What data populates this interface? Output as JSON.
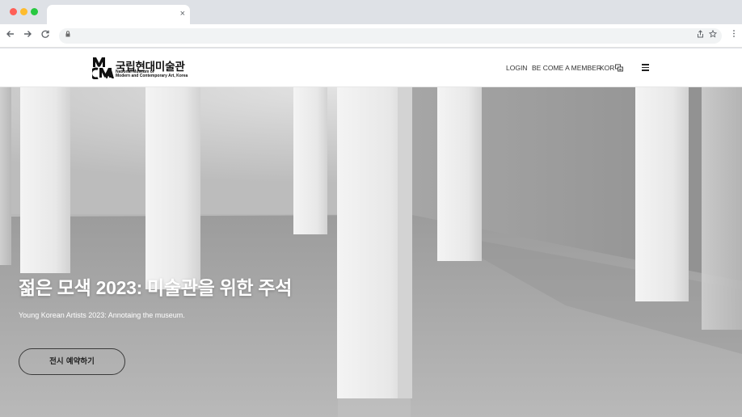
{
  "browser": {
    "tab_close": "×",
    "url": ""
  },
  "header": {
    "logo": {
      "mark": "MMCA",
      "korean_name": "국립현대미술관",
      "english_line1": "National Museum of",
      "english_line2": "Modern and Contemporary Art, Korea"
    },
    "login": "LOGIN",
    "become_member": "BE COME A MEMBER",
    "language": "KOR",
    "icons": {
      "language": "language-icon",
      "menu": "hamburger-menu-icon"
    }
  },
  "hero": {
    "title": "젊은 모색 2023: 미술관을 위한 주석",
    "subtitle": "Young Korean Artists 2023: Annotaing the museum.",
    "button": "전시 예약하기"
  },
  "colors": {
    "hero_floor": "#a9a9a9",
    "hero_wall": "#c9c9c9",
    "pillar": "#ececec",
    "text_light": "#ffffff"
  }
}
